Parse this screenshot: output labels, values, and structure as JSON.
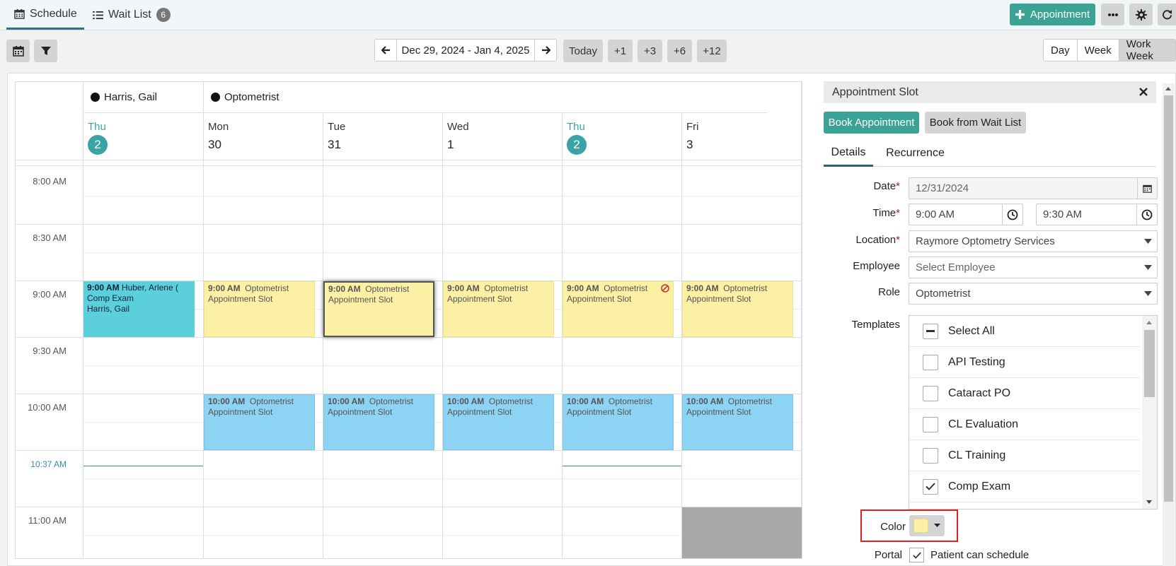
{
  "top_tabs": {
    "schedule": "Schedule",
    "wait_list": "Wait List",
    "wait_list_count": "6"
  },
  "top_actions": {
    "appointment": "Appointment"
  },
  "nav": {
    "date_range": "Dec 29, 2024 - Jan 4, 2025",
    "today": "Today",
    "jumps": [
      "+1",
      "+3",
      "+6",
      "+12"
    ],
    "views": [
      "Day",
      "Week",
      "Work Week"
    ],
    "active_view": "Work Week"
  },
  "calendar": {
    "resources": [
      {
        "name": "Harris, Gail",
        "color": "#111111"
      },
      {
        "name": "Optometrist",
        "color": "#111111"
      }
    ],
    "days": [
      {
        "name": "Thu",
        "num": "2",
        "today": true
      },
      {
        "name": "Mon",
        "num": "30",
        "today": false
      },
      {
        "name": "Tue",
        "num": "31",
        "today": false
      },
      {
        "name": "Wed",
        "num": "1",
        "today": false
      },
      {
        "name": "Thu",
        "num": "2",
        "today": true
      },
      {
        "name": "Fri",
        "num": "3",
        "today": false
      }
    ],
    "times": [
      "8:00 AM",
      "8:30 AM",
      "9:00 AM",
      "9:30 AM",
      "10:00 AM",
      "10:37 AM",
      "11:00 AM"
    ],
    "current_time": "10:37 AM",
    "events": [
      {
        "time": "9:00 AM",
        "line1": "Huber, Arlene  (",
        "line2": "Comp Exam",
        "line3": "Harris, Gail",
        "color": "cyan"
      },
      {
        "time": "9:00 AM",
        "line1": "Optometrist",
        "line2": "Appointment Slot",
        "color": "yellow"
      },
      {
        "time": "9:00 AM",
        "line1": "Optometrist",
        "line2": "Appointment Slot",
        "color": "yellow",
        "selected": true
      },
      {
        "time": "9:00 AM",
        "line1": "Optometrist",
        "line2": "Appointment Slot",
        "color": "yellow"
      },
      {
        "time": "9:00 AM",
        "line1": "Optometrist",
        "line2": "Appointment Slot",
        "color": "yellow",
        "blocked": true
      },
      {
        "time": "9:00 AM",
        "line1": "Optometrist",
        "line2": "Appointment Slot",
        "color": "yellow"
      },
      {
        "time": "10:00 AM",
        "line1": "Optometrist",
        "line2": "Appointment Slot",
        "color": "blue"
      },
      {
        "time": "10:00 AM",
        "line1": "Optometrist",
        "line2": "Appointment Slot",
        "color": "blue"
      },
      {
        "time": "10:00 AM",
        "line1": "Optometrist",
        "line2": "Appointment Slot",
        "color": "blue"
      },
      {
        "time": "10:00 AM",
        "line1": "Optometrist",
        "line2": "Appointment Slot",
        "color": "blue"
      },
      {
        "time": "10:00 AM",
        "line1": "Optometrist",
        "line2": "Appointment Slot",
        "color": "blue"
      }
    ]
  },
  "panel": {
    "title": "Appointment Slot",
    "book_appointment": "Book Appointment",
    "book_from_wait_list": "Book from Wait List",
    "tabs": [
      "Details",
      "Recurrence"
    ],
    "active_tab": "Details",
    "labels": {
      "date": "Date",
      "time": "Time",
      "location": "Location",
      "employee": "Employee",
      "role": "Role",
      "templates": "Templates",
      "color": "Color",
      "portal": "Portal"
    },
    "date": "12/31/2024",
    "time_start": "9:00 AM",
    "time_end": "9:30 AM",
    "location": "Raymore Optometry Services",
    "employee_placeholder": "Select Employee",
    "role": "Optometrist",
    "templates": [
      {
        "label": "Select All",
        "state": "partial"
      },
      {
        "label": "API Testing",
        "state": "unchecked"
      },
      {
        "label": "Cataract PO",
        "state": "unchecked"
      },
      {
        "label": "CL Evaluation",
        "state": "unchecked"
      },
      {
        "label": "CL Training",
        "state": "unchecked"
      },
      {
        "label": "Comp Exam",
        "state": "checked"
      }
    ],
    "color_value": "#fcf0a5",
    "portal_text": "Patient can schedule"
  },
  "colors": {
    "accent": "#3aa396",
    "today": "#3aa3a6",
    "highlight_box": "#e02020"
  }
}
